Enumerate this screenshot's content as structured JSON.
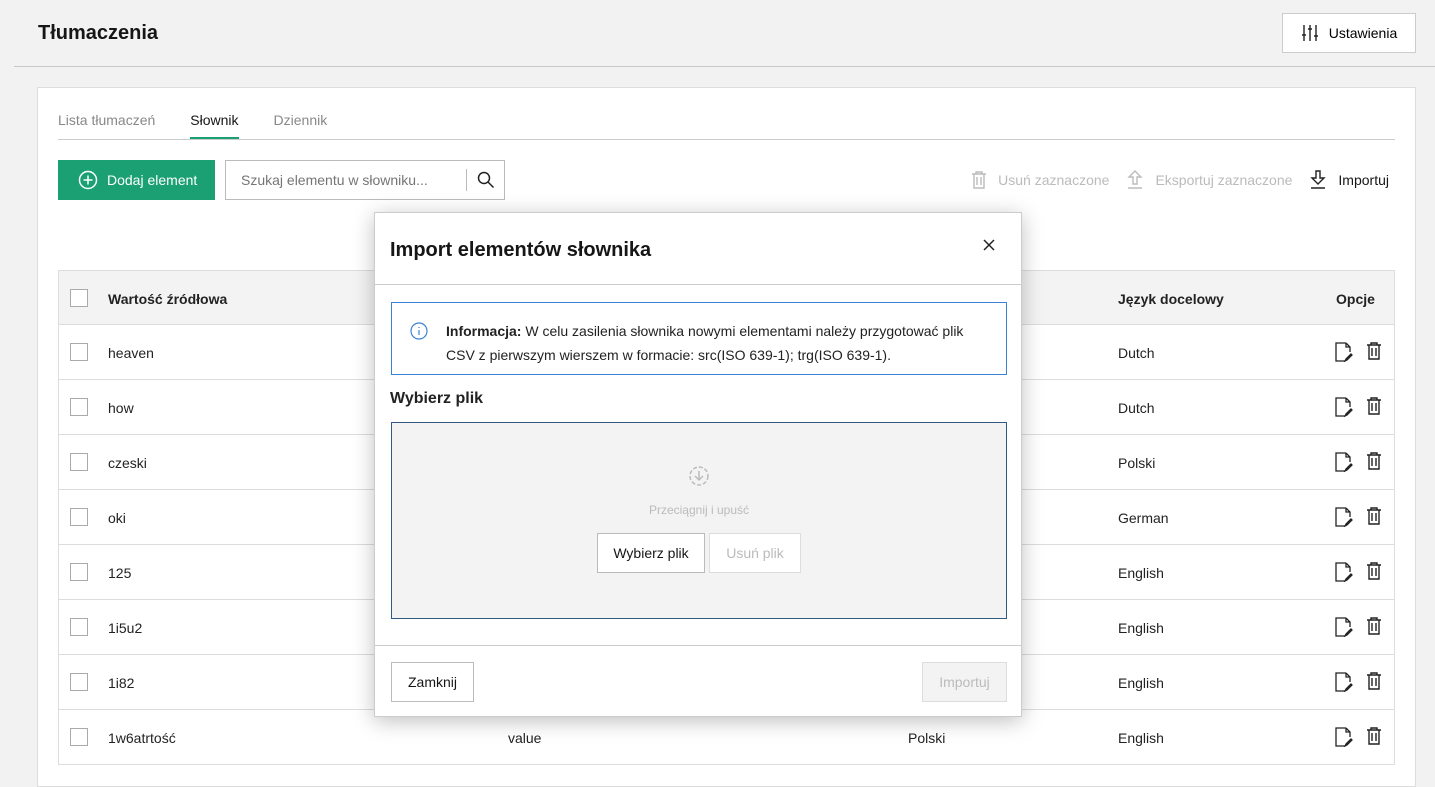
{
  "header": {
    "title": "Tłumaczenia",
    "settings_label": "Ustawienia"
  },
  "tabs": [
    {
      "label": "Lista tłumaczeń"
    },
    {
      "label": "Słownik",
      "active": true
    },
    {
      "label": "Dziennik"
    }
  ],
  "toolbar": {
    "add_label": "Dodaj element",
    "search_placeholder": "Szukaj elementu w słowniku...",
    "delete_selected": "Usuń zaznaczone",
    "export_selected": "Eksportuj zaznaczone",
    "import": "Importuj"
  },
  "table": {
    "headers": {
      "source": "Wartość źródłowa",
      "target_lang": "Język docelowy",
      "options": "Opcje"
    },
    "rows": [
      {
        "source": "heaven",
        "target_value": "",
        "source_lang": "",
        "target_lang": "Dutch"
      },
      {
        "source": "how",
        "target_value": "",
        "source_lang": "",
        "target_lang": "Dutch"
      },
      {
        "source": "czeski",
        "target_value": "",
        "source_lang": "",
        "target_lang": "Polski"
      },
      {
        "source": "oki",
        "target_value": "",
        "source_lang": "",
        "target_lang": "German"
      },
      {
        "source": "125",
        "target_value": "",
        "source_lang": "",
        "target_lang": "English"
      },
      {
        "source": "1i5u2",
        "target_value": "",
        "source_lang": "",
        "target_lang": "English"
      },
      {
        "source": "1i82",
        "target_value": "",
        "source_lang": "",
        "target_lang": "English"
      },
      {
        "source": "1w6atrtość",
        "target_value": "value",
        "source_lang": "Polski",
        "target_lang": "English"
      }
    ]
  },
  "modal": {
    "title": "Import elementów słownika",
    "info_bold": "Informacja:",
    "info_text": " W celu zasilenia słownika nowymi elementami należy przygotować plik CSV z pierwszym wierszem w formacie: src(ISO 639-1); trg(ISO 639-1).",
    "choose_label": "Wybierz plik",
    "drop_text": "Przeciągnij i upuść",
    "choose_button": "Wybierz plik",
    "remove_button": "Usuń plik",
    "close_button": "Zamknij",
    "import_button": "Importuj"
  },
  "colors": {
    "accent": "#1aa073",
    "info_border": "#3b82d6"
  }
}
